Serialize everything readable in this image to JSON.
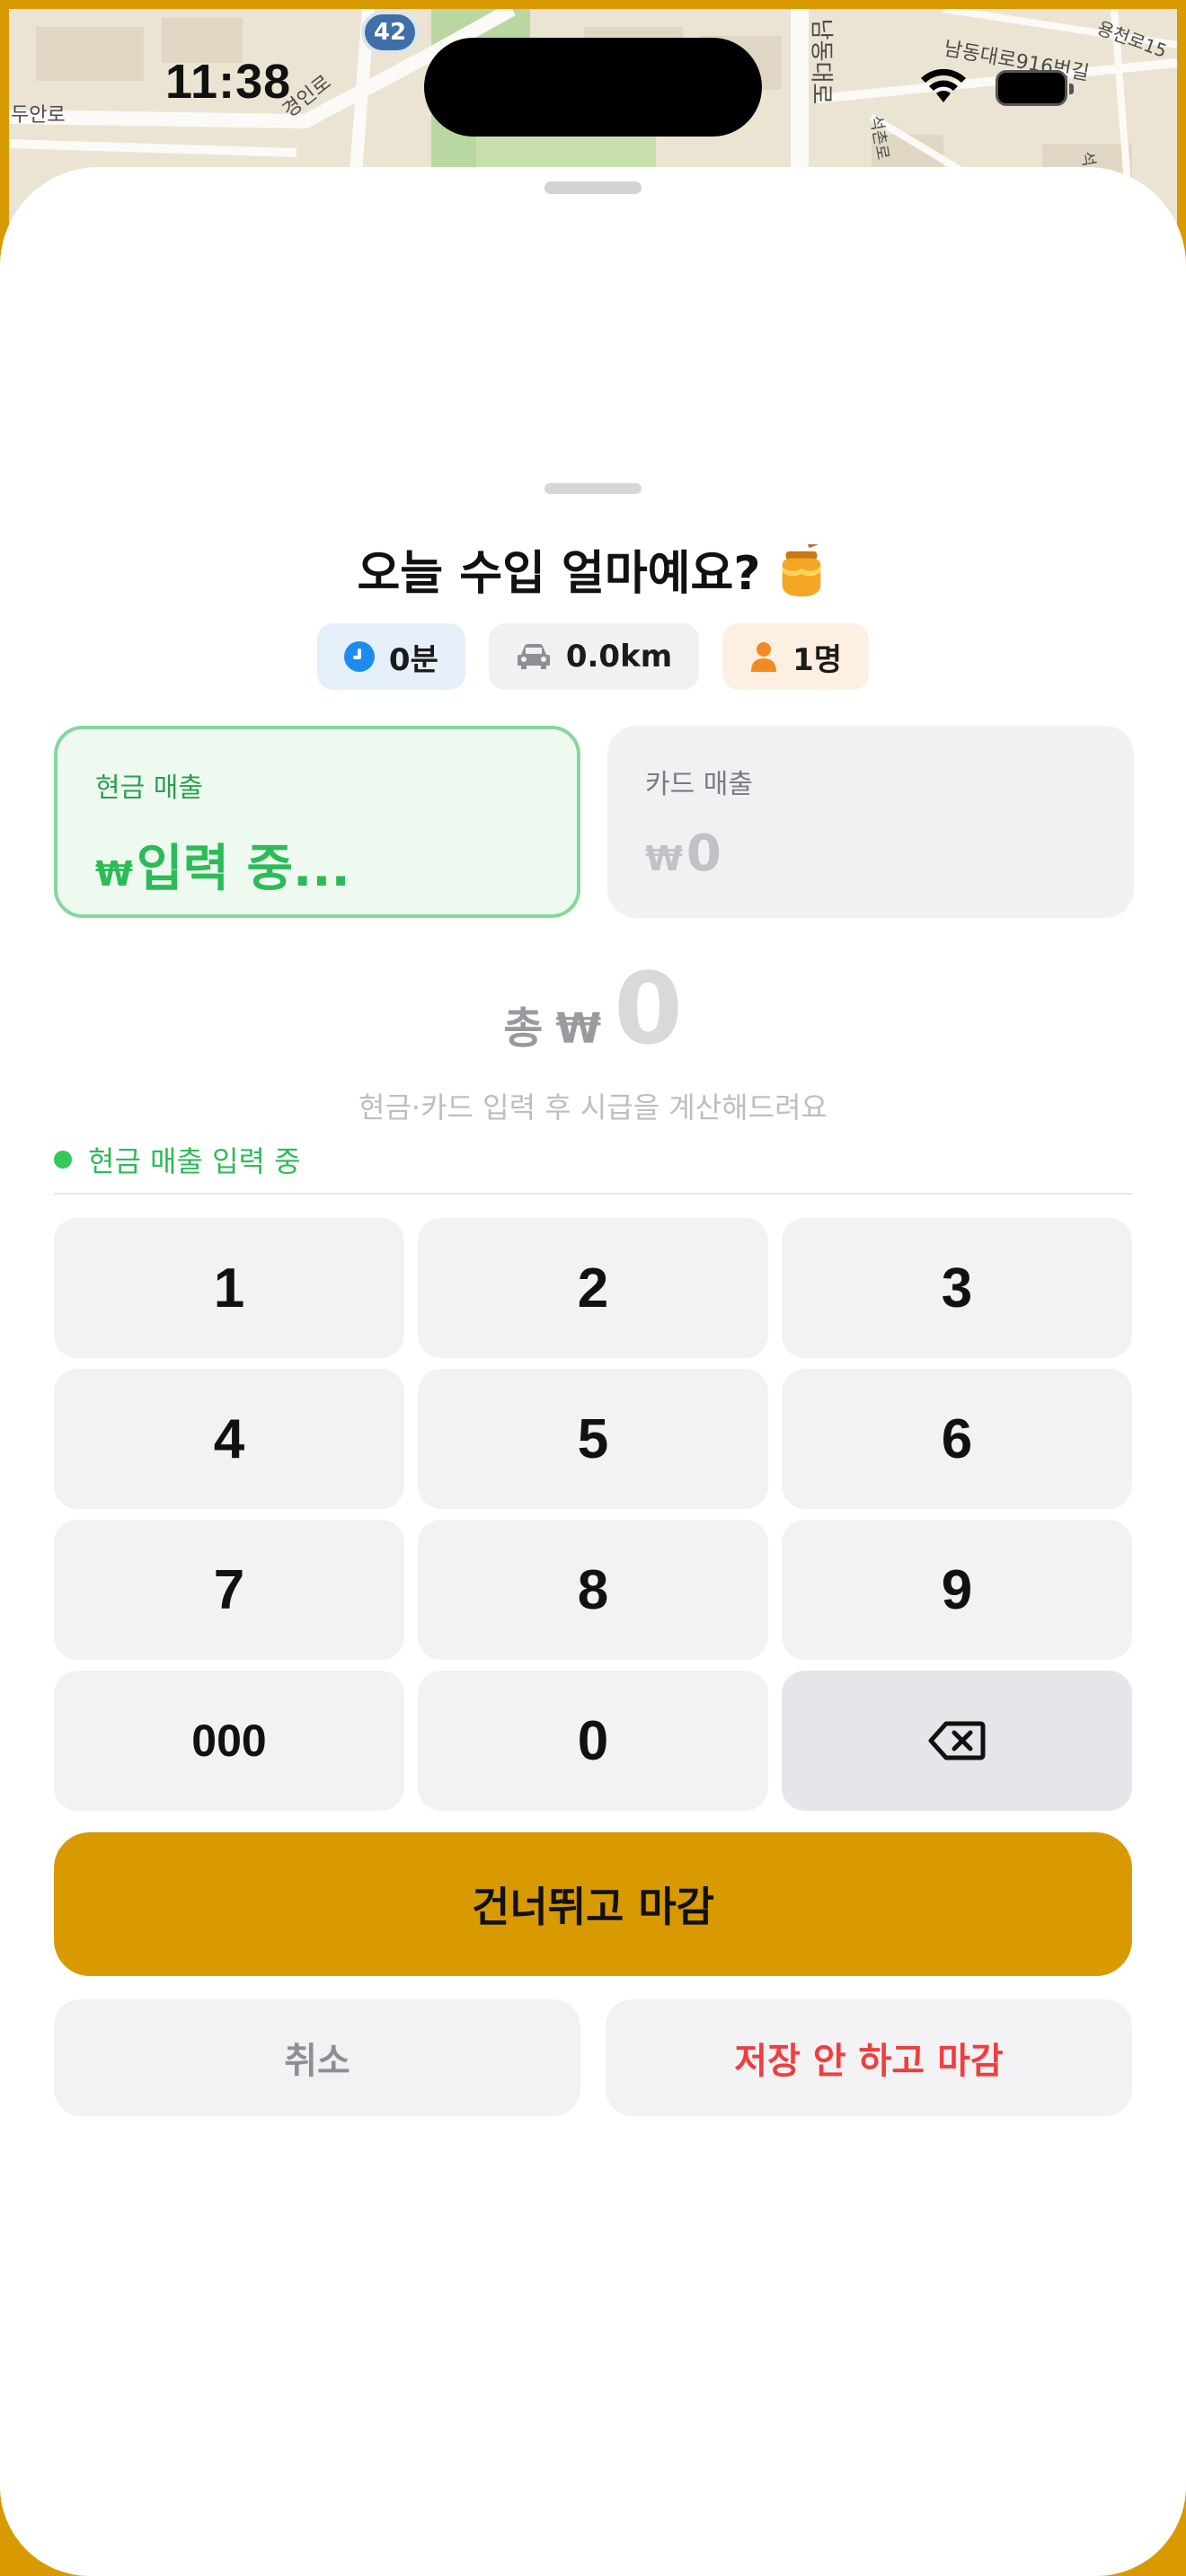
{
  "status_bar": {
    "time": "11:38"
  },
  "map": {
    "labels": [
      "경인로",
      "남동대로",
      "남동대로916번길",
      "용천로15",
      "두안로",
      "석촌로",
      "석산로"
    ],
    "route_number": "42"
  },
  "sheet": {
    "title": "오늘 수입 얼마예요?",
    "title_emoji_icon": "honey-pot-icon"
  },
  "chips": {
    "time": "0분",
    "distance": "0.0km",
    "passengers": "1명"
  },
  "cash_card": {
    "label": "현금 매출",
    "currency": "₩",
    "value": "입력 중..."
  },
  "card_card": {
    "label": "카드 매출",
    "currency": "₩",
    "value": "0"
  },
  "total": {
    "label": "총",
    "currency": "₩",
    "value": "0"
  },
  "hint": "현금·카드 입력 후 시급을 계산해드려요",
  "input_status": "현금 매출 입력 중",
  "keypad": {
    "k1": "1",
    "k2": "2",
    "k3": "3",
    "k4": "4",
    "k5": "5",
    "k6": "6",
    "k7": "7",
    "k8": "8",
    "k9": "9",
    "k000": "000",
    "k0": "0",
    "backspace_icon": "delete-left-icon"
  },
  "buttons": {
    "skip_close": "건너뛰고 마감",
    "cancel": "취소",
    "close_without_save": "저장 안 하고 마감"
  },
  "colors": {
    "accent": "#d89a00",
    "cash_green": "#2dbb58",
    "danger": "#ef3e3e",
    "key_bg": "#f2f2f5"
  }
}
